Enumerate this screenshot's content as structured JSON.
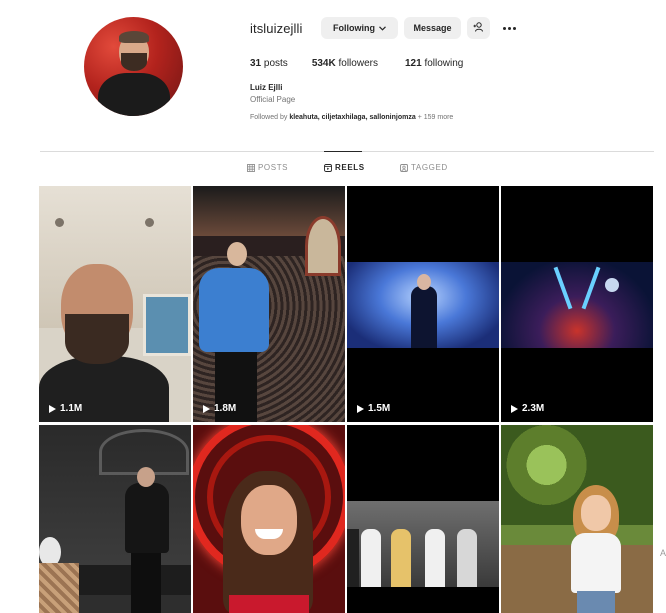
{
  "profile": {
    "username": "itsluizejlli",
    "following_button": "Following",
    "message_button": "Message",
    "stats": {
      "posts_count": "31",
      "posts_label": "posts",
      "followers_count": "534K",
      "followers_label": "followers",
      "following_count": "121",
      "following_label": "following"
    },
    "full_name": "Luiz Ejlli",
    "category": "Official Page",
    "followed_by": {
      "prefix": "Followed by",
      "names": "kleahuta, ciljetaxhilaga, salloninjomza",
      "suffix": "+ 159 more"
    }
  },
  "tabs": [
    {
      "label": "POSTS",
      "active": false,
      "icon": "grid-icon"
    },
    {
      "label": "REELS",
      "active": true,
      "icon": "reels-icon"
    },
    {
      "label": "TAGGED",
      "active": false,
      "icon": "tagged-icon"
    }
  ],
  "reels": [
    {
      "views": "1.1M"
    },
    {
      "views": "1.8M"
    },
    {
      "views": "1.5M"
    },
    {
      "views": "2.3M"
    },
    {
      "views": ""
    },
    {
      "views": ""
    },
    {
      "views": ""
    },
    {
      "views": ""
    }
  ],
  "edge_letter": "A",
  "colors": {
    "text": "#262626",
    "secondary": "#737373",
    "button_bg": "#efefef",
    "divider": "#dbdbdb"
  }
}
